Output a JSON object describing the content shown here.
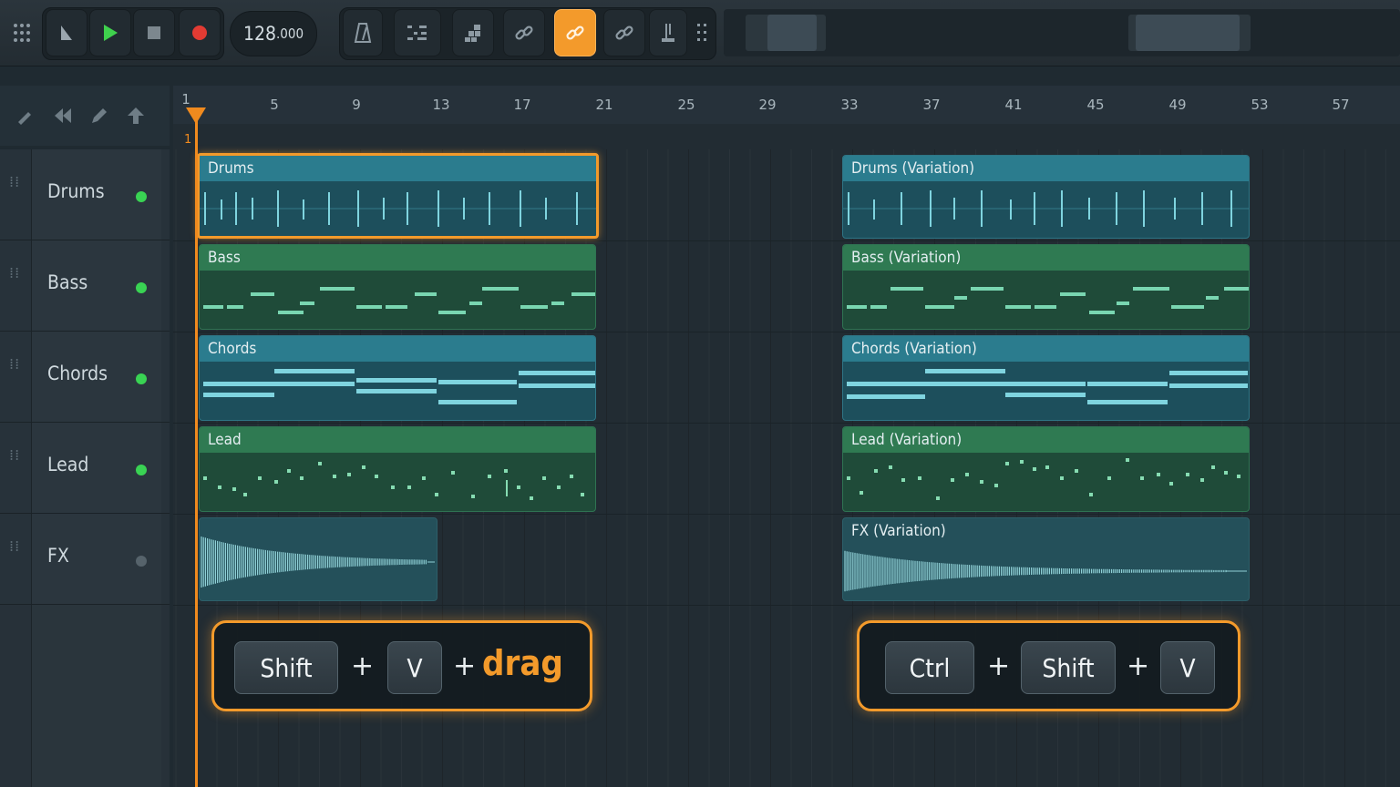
{
  "toolbar": {
    "tempo_main": "128",
    "tempo_frac": ".000",
    "buttons": [
      {
        "icon": "grid-menu-icon"
      },
      {
        "icon": "pattern-song-icon"
      },
      {
        "icon": "play-icon"
      },
      {
        "icon": "stop-icon"
      },
      {
        "icon": "record-icon"
      },
      {
        "icon": "metronome-icon"
      },
      {
        "icon": "step-icon"
      },
      {
        "icon": "blocks-icon"
      },
      {
        "icon": "link-icon"
      },
      {
        "icon": "make-unique-link-icon",
        "active": true
      },
      {
        "icon": "link-alt-icon"
      },
      {
        "icon": "tuner-icon"
      },
      {
        "icon": "more-icon"
      }
    ]
  },
  "ruler": {
    "bars": [
      "1",
      "5",
      "9",
      "13",
      "17",
      "21",
      "25",
      "29",
      "33",
      "37",
      "41",
      "45",
      "49",
      "53",
      "57"
    ],
    "marker": "1"
  },
  "tracks": [
    {
      "name": "Drums",
      "active": true
    },
    {
      "name": "Bass",
      "active": true
    },
    {
      "name": "Chords",
      "active": true
    },
    {
      "name": "Lead",
      "active": true
    },
    {
      "name": "FX",
      "active": false
    }
  ],
  "clips": {
    "drums_a": "Drums",
    "bass_a": "Bass",
    "chords_a": "Chords",
    "lead_a": "Lead",
    "drums_b": "Drums (Variation)",
    "bass_b": "Bass (Variation)",
    "chords_b": "Chords  (Variation)",
    "lead_b": "Lead (Variation)",
    "fx_b": "FX (Variation)"
  },
  "shortcuts": {
    "left": {
      "k1": "Shift",
      "plus1": "+",
      "k2": "V",
      "plus2": "+",
      "action": "drag"
    },
    "right": {
      "k1": "Ctrl",
      "plus1": "+",
      "k2": "Shift",
      "plus2": "+",
      "k3": "V"
    }
  },
  "colors": {
    "accent": "#f39a2b",
    "led_on": "#39d353",
    "led_off": "#56636b"
  }
}
